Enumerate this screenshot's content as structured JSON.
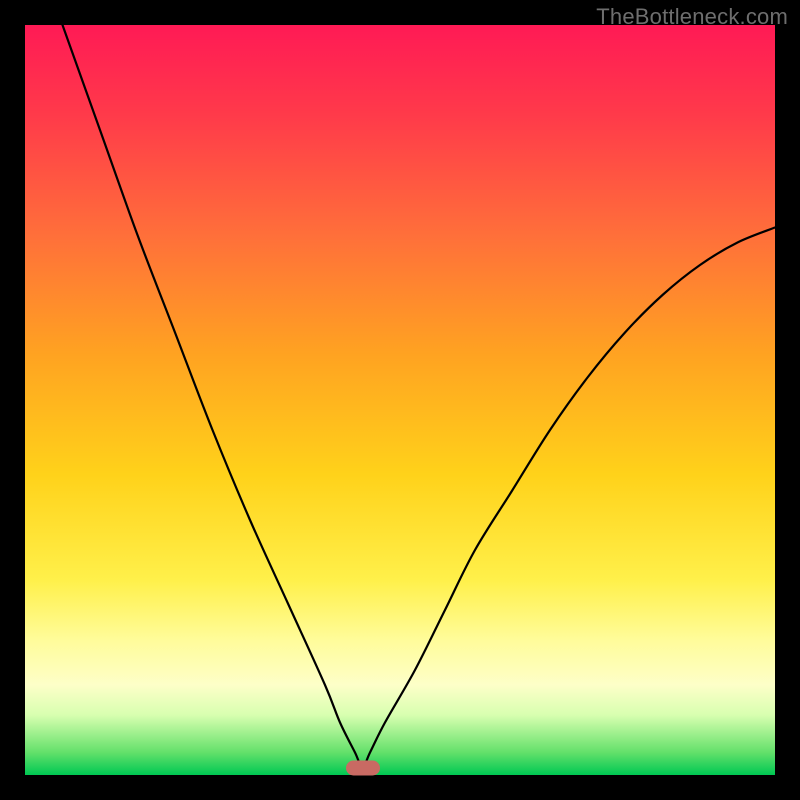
{
  "watermark": "TheBottleneck.com",
  "chart_data": {
    "type": "line",
    "title": "",
    "xlabel": "",
    "ylabel": "",
    "xlim": [
      0,
      100
    ],
    "ylim": [
      0,
      100
    ],
    "series": [
      {
        "name": "bottleneck-curve",
        "x": [
          5,
          10,
          15,
          20,
          25,
          30,
          35,
          40,
          42,
          44,
          45,
          46,
          48,
          52,
          56,
          60,
          65,
          70,
          75,
          80,
          85,
          90,
          95,
          100
        ],
        "y": [
          100,
          86,
          72,
          59,
          46,
          34,
          23,
          12,
          7,
          3,
          1,
          3,
          7,
          14,
          22,
          30,
          38,
          46,
          53,
          59,
          64,
          68,
          71,
          73
        ]
      }
    ],
    "marker": {
      "x": 45,
      "y": 1
    },
    "background_gradient": {
      "top": "#ff1a55",
      "mid_upper": "#ff9a2a",
      "mid": "#ffe038",
      "mid_lower": "#fdffc8",
      "bottom": "#00c853"
    }
  }
}
